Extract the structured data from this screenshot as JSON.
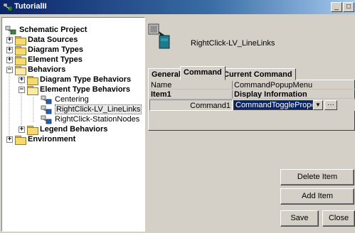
{
  "window": {
    "title": "TutorialII",
    "min_glyph": "_",
    "max_glyph": "□"
  },
  "tree": {
    "items": [
      {
        "label": "Schematic Project"
      },
      {
        "label": "Data Sources",
        "toggle": "+"
      },
      {
        "label": "Diagram Types",
        "toggle": "+"
      },
      {
        "label": "Element Types",
        "toggle": "+"
      },
      {
        "label": "Behaviors",
        "toggle": "−"
      },
      {
        "label": "Diagram Type Behaviors",
        "toggle": "+"
      },
      {
        "label": "Element Type Behaviors",
        "toggle": "−"
      },
      {
        "label": "Centering"
      },
      {
        "label": "RightClick-LV_LineLinks"
      },
      {
        "label": "RightClick-StationNodes"
      },
      {
        "label": "Legend Behaviors",
        "toggle": "+"
      },
      {
        "label": "Environment",
        "toggle": "+"
      }
    ]
  },
  "details": {
    "header_label": "RightClick-LV_LineLinks",
    "tabs": [
      "General",
      "Command",
      "Current Command"
    ],
    "active_tab": "Command",
    "grid": {
      "rows": [
        {
          "key": "Name",
          "value": "CommandPopupMenu"
        },
        {
          "key": "Item1",
          "value": "Display Information"
        }
      ]
    },
    "command": {
      "label": "Command1",
      "selected": "CommandTogglePropertyState",
      "dropdown_glyph": "▼",
      "more_glyph": "···"
    }
  },
  "buttons": {
    "delete": "Delete Item",
    "add": "Add Item",
    "save": "Save",
    "close": "Close"
  }
}
